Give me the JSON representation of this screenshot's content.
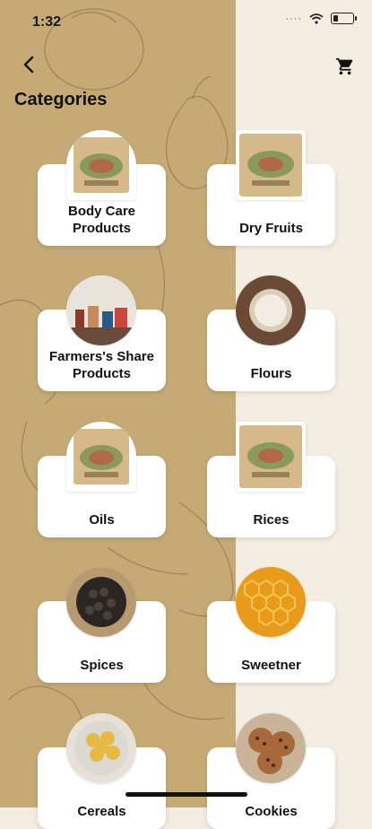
{
  "status_bar": {
    "time": "1:32"
  },
  "header": {
    "title": "Categories",
    "back_icon": "chevron-left-icon",
    "cart_icon": "cart-icon"
  },
  "colors": {
    "left_background": "#c6aa76",
    "right_background": "#f4eee2",
    "card": "#ffffff",
    "text": "#111111"
  },
  "categories": [
    {
      "label": "Body Care\nProducts",
      "image": "product-pack"
    },
    {
      "label": "Dry Fruits",
      "image": "product-pack"
    },
    {
      "label": "Farmers's Share\nProducts",
      "image": "farmers-products"
    },
    {
      "label": "Flours",
      "image": "flour-bowl"
    },
    {
      "label": "Oils",
      "image": "product-pack"
    },
    {
      "label": "Rices",
      "image": "product-pack"
    },
    {
      "label": "Spices",
      "image": "peppercorns"
    },
    {
      "label": "Sweetner",
      "image": "honeycomb"
    },
    {
      "label": "Cereals",
      "image": "cornflakes"
    },
    {
      "label": "Cookies",
      "image": "cookies"
    }
  ]
}
